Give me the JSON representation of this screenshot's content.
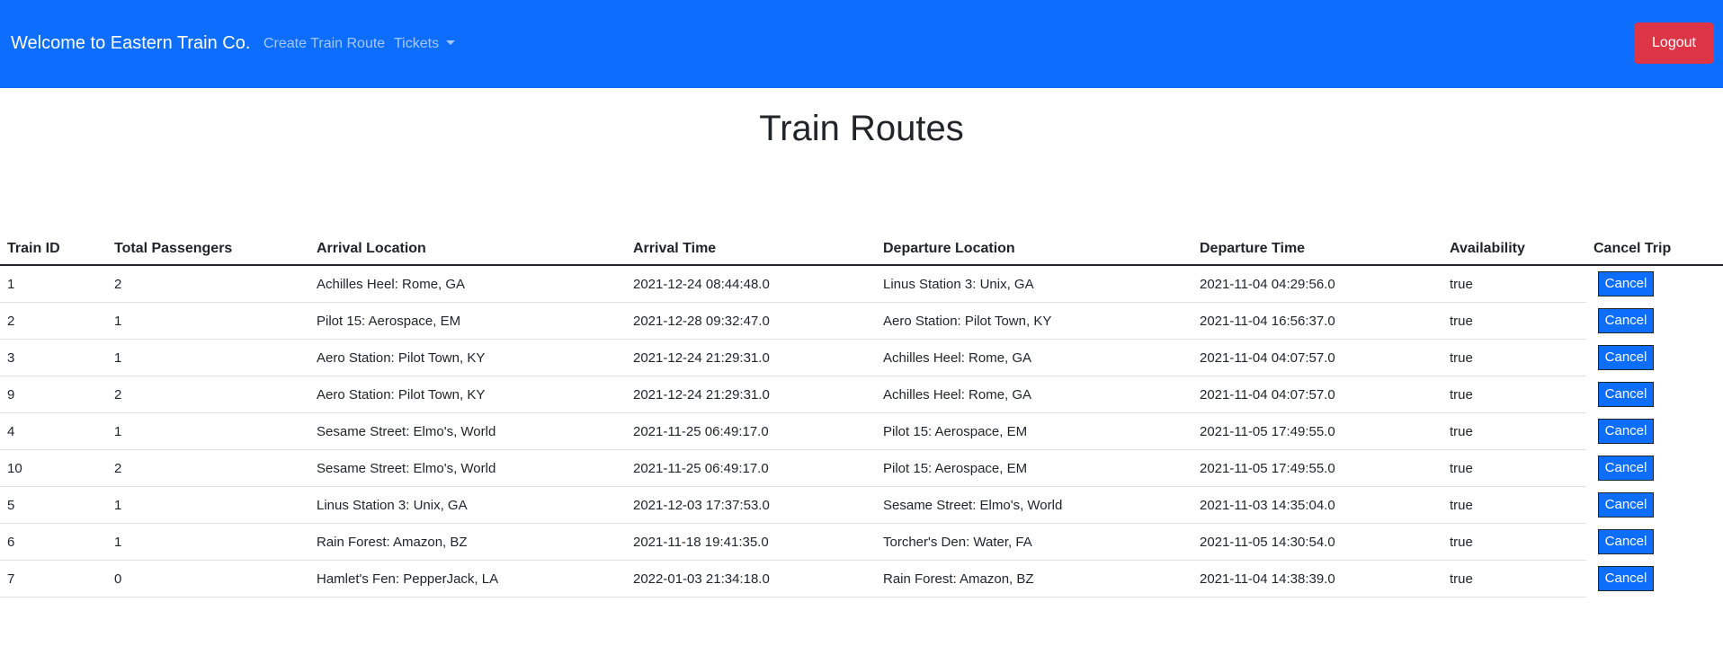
{
  "navbar": {
    "brand": "Welcome to Eastern Train Co.",
    "links": {
      "create_route": "Create Train Route",
      "tickets": "Tickets"
    },
    "logout_label": "Logout",
    "bg_color": "#0d6efd",
    "logout_color": "#dc3545"
  },
  "page": {
    "title": "Train Routes"
  },
  "table": {
    "headers": [
      "Train ID",
      "Total Passengers",
      "Arrival Location",
      "Arrival Time",
      "Departure Location",
      "Departure Time",
      "Availability",
      "Cancel Trip"
    ],
    "cancel_label": "Cancel",
    "rows": [
      {
        "train_id": "1",
        "passengers": "2",
        "arrival_location": "Achilles Heel: Rome, GA",
        "arrival_time": "2021-12-24 08:44:48.0",
        "departure_location": "Linus Station 3: Unix, GA",
        "departure_time": "2021-11-04 04:29:56.0",
        "availability": "true"
      },
      {
        "train_id": "2",
        "passengers": "1",
        "arrival_location": "Pilot 15: Aerospace, EM",
        "arrival_time": "2021-12-28 09:32:47.0",
        "departure_location": "Aero Station: Pilot Town, KY",
        "departure_time": "2021-11-04 16:56:37.0",
        "availability": "true"
      },
      {
        "train_id": "3",
        "passengers": "1",
        "arrival_location": "Aero Station: Pilot Town, KY",
        "arrival_time": "2021-12-24 21:29:31.0",
        "departure_location": "Achilles Heel: Rome, GA",
        "departure_time": "2021-11-04 04:07:57.0",
        "availability": "true"
      },
      {
        "train_id": "9",
        "passengers": "2",
        "arrival_location": "Aero Station: Pilot Town, KY",
        "arrival_time": "2021-12-24 21:29:31.0",
        "departure_location": "Achilles Heel: Rome, GA",
        "departure_time": "2021-11-04 04:07:57.0",
        "availability": "true"
      },
      {
        "train_id": "4",
        "passengers": "1",
        "arrival_location": "Sesame Street: Elmo's, World",
        "arrival_time": "2021-11-25 06:49:17.0",
        "departure_location": "Pilot 15: Aerospace, EM",
        "departure_time": "2021-11-05 17:49:55.0",
        "availability": "true"
      },
      {
        "train_id": "10",
        "passengers": "2",
        "arrival_location": "Sesame Street: Elmo's, World",
        "arrival_time": "2021-11-25 06:49:17.0",
        "departure_location": "Pilot 15: Aerospace, EM",
        "departure_time": "2021-11-05 17:49:55.0",
        "availability": "true"
      },
      {
        "train_id": "5",
        "passengers": "1",
        "arrival_location": "Linus Station 3: Unix, GA",
        "arrival_time": "2021-12-03 17:37:53.0",
        "departure_location": "Sesame Street: Elmo's, World",
        "departure_time": "2021-11-03 14:35:04.0",
        "availability": "true"
      },
      {
        "train_id": "6",
        "passengers": "1",
        "arrival_location": "Rain Forest: Amazon, BZ",
        "arrival_time": "2021-11-18 19:41:35.0",
        "departure_location": "Torcher's Den: Water, FA",
        "departure_time": "2021-11-05 14:30:54.0",
        "availability": "true"
      },
      {
        "train_id": "7",
        "passengers": "0",
        "arrival_location": "Hamlet's Fen: PepperJack, LA",
        "arrival_time": "2022-01-03 21:34:18.0",
        "departure_location": "Rain Forest: Amazon, BZ",
        "departure_time": "2021-11-04 14:38:39.0",
        "availability": "true"
      }
    ]
  }
}
